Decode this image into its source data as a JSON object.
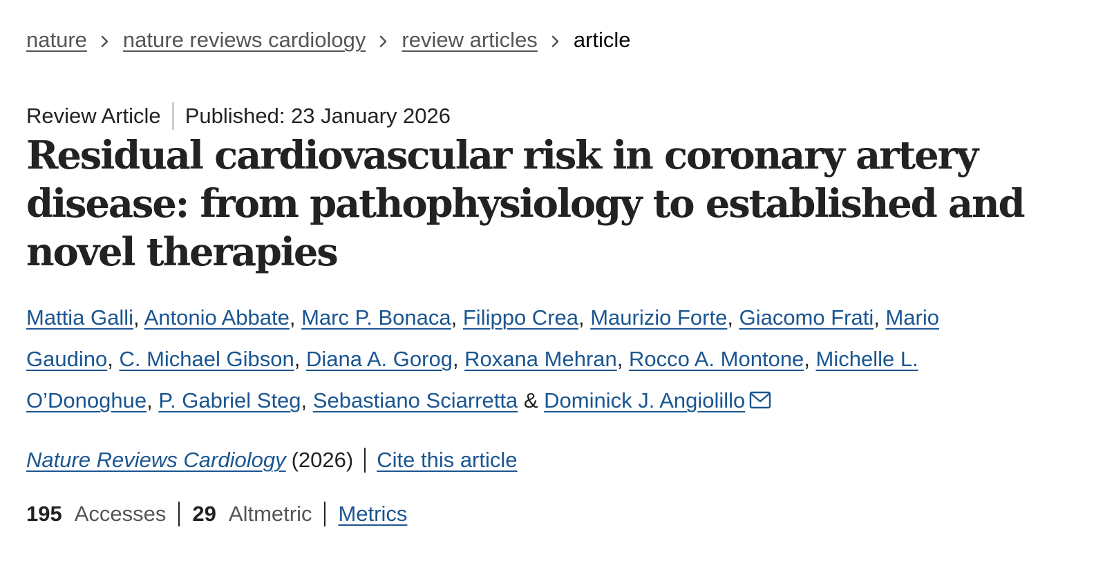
{
  "breadcrumb": {
    "items": [
      "nature",
      "nature reviews cardiology",
      "review articles"
    ],
    "current": "article",
    "separator_icon": "chevron-right-icon"
  },
  "meta": {
    "type": "Review Article",
    "published": "Published: 23 January 2026"
  },
  "title": "Residual cardiovascular risk in coronary artery disease: from pathophysiology to established and novel therapies",
  "authors": {
    "list": [
      "Mattia Galli",
      "Antonio Abbate",
      "Marc P. Bonaca",
      "Filippo Crea",
      "Maurizio Forte",
      "Giacomo Frati",
      "Mario Gaudino",
      "C. Michael Gibson",
      "Diana A. Gorog",
      "Roxana Mehran",
      "Rocco A. Montone",
      "Michelle L. O’Donoghue",
      "P. Gabriel Steg",
      "Sebastiano Sciarretta",
      "Dominick J. Angiolillo"
    ],
    "last_joiner": "&",
    "contact_icon": "mail-icon"
  },
  "journal": {
    "name": "Nature Reviews Cardiology",
    "year": "(2026)",
    "cite_label": "Cite this article"
  },
  "metrics": {
    "accesses_count": "195",
    "accesses_label": "Accesses",
    "altmetric_count": "29",
    "altmetric_label": "Altmetric",
    "metrics_link": "Metrics"
  },
  "colors": {
    "link": "#1a5591",
    "text": "#222222",
    "muted": "#555555"
  }
}
